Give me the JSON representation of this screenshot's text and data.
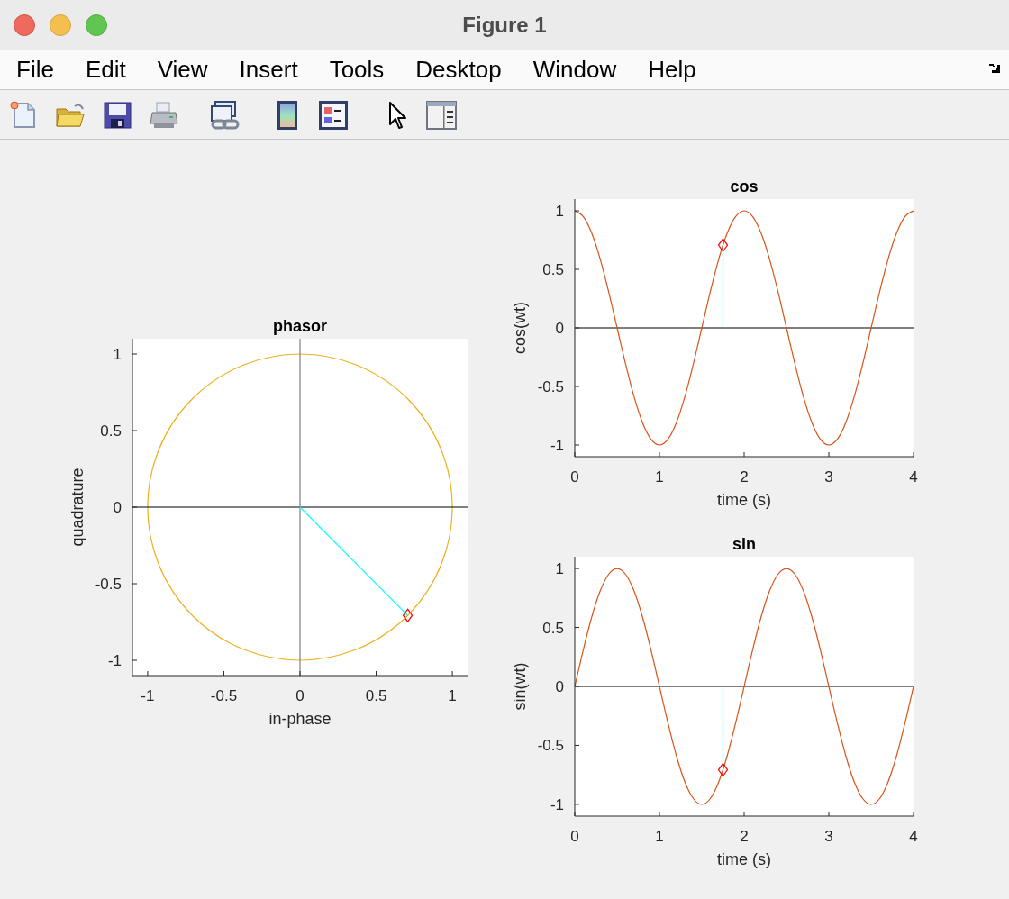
{
  "window": {
    "title": "Figure 1"
  },
  "menu": [
    "File",
    "Edit",
    "View",
    "Insert",
    "Tools",
    "Desktop",
    "Window",
    "Help"
  ],
  "axes": [
    {
      "chart_data": {
        "type": "line",
        "title": "phasor",
        "xlabel": "in-phase",
        "ylabel": "quadrature",
        "xlim": [
          -1.1,
          1.1
        ],
        "ylim": [
          -1.1,
          1.1
        ],
        "xticks": [
          -1,
          -0.5,
          0,
          0.5,
          1
        ],
        "yticks": [
          -1,
          -0.5,
          0,
          0.5,
          1
        ],
        "ref_lines": [
          {
            "axis": "y",
            "value": 0,
            "color": "#000000"
          },
          {
            "axis": "x",
            "value": 0,
            "color": "#808080"
          }
        ],
        "series": [
          {
            "color": "#00ffff",
            "x": [
              0,
              0.707
            ],
            "values": [
              0,
              -0.707
            ]
          },
          {
            "color": "#ff0000",
            "marker": "diamond",
            "x": [
              0.707
            ],
            "values": [
              -0.707
            ]
          }
        ]
      }
    },
    {
      "chart_data": {
        "type": "line",
        "title": "cos",
        "xlabel": "time (s)",
        "ylabel": "cos(wt)",
        "xlim": [
          0,
          4
        ],
        "ylim": [
          -1.1,
          1.1
        ],
        "xticks": [
          0,
          1,
          2,
          3,
          4
        ],
        "yticks": [
          -1,
          -0.5,
          0,
          0.5,
          1
        ],
        "ref_lines": [
          {
            "axis": "y",
            "value": 0,
            "color": "#000000"
          }
        ],
        "series": [
          {
            "color": "#d95319",
            "x": [
              0,
              0.1,
              0.2,
              0.3,
              0.4,
              0.5,
              0.6,
              0.7,
              0.8,
              0.9,
              1,
              1.1,
              1.2,
              1.3,
              1.4,
              1.5,
              1.6,
              1.7,
              1.8,
              1.9,
              2,
              2.1,
              2.2,
              2.3,
              2.4,
              2.5,
              2.6,
              2.7,
              2.8,
              2.9,
              3,
              3.1,
              3.2,
              3.3,
              3.4,
              3.5,
              3.6,
              3.7,
              3.8,
              3.9,
              4
            ],
            "values": [
              1,
              0.951,
              0.809,
              0.588,
              0.309,
              0,
              -0.309,
              -0.588,
              -0.809,
              -0.951,
              -1,
              -0.951,
              -0.809,
              -0.588,
              -0.309,
              0,
              0.309,
              0.588,
              0.809,
              0.951,
              1,
              0.951,
              0.809,
              0.588,
              0.309,
              0,
              -0.309,
              -0.588,
              -0.809,
              -0.951,
              -1,
              -0.951,
              -0.809,
              -0.588,
              -0.309,
              0,
              0.309,
              0.588,
              0.809,
              0.951,
              1
            ]
          },
          {
            "color": "#00ffff",
            "x": [
              1.75,
              1.75
            ],
            "values": [
              0,
              0.707
            ]
          },
          {
            "color": "#ff0000",
            "marker": "diamond",
            "x": [
              1.75
            ],
            "values": [
              0.707
            ]
          }
        ]
      }
    },
    {
      "chart_data": {
        "type": "line",
        "title": "sin",
        "xlabel": "time (s)",
        "ylabel": "sin(wt)",
        "xlim": [
          0,
          4
        ],
        "ylim": [
          -1.1,
          1.1
        ],
        "xticks": [
          0,
          1,
          2,
          3,
          4
        ],
        "yticks": [
          -1,
          -0.5,
          0,
          0.5,
          1
        ],
        "ref_lines": [
          {
            "axis": "y",
            "value": 0,
            "color": "#000000"
          }
        ],
        "series": [
          {
            "color": "#d95319",
            "x": [
              0,
              0.1,
              0.2,
              0.3,
              0.4,
              0.5,
              0.6,
              0.7,
              0.8,
              0.9,
              1,
              1.1,
              1.2,
              1.3,
              1.4,
              1.5,
              1.6,
              1.7,
              1.8,
              1.9,
              2,
              2.1,
              2.2,
              2.3,
              2.4,
              2.5,
              2.6,
              2.7,
              2.8,
              2.9,
              3,
              3.1,
              3.2,
              3.3,
              3.4,
              3.5,
              3.6,
              3.7,
              3.8,
              3.9,
              4
            ],
            "values": [
              0,
              0.309,
              0.588,
              0.809,
              0.951,
              1,
              0.951,
              0.809,
              0.588,
              0.309,
              0,
              -0.309,
              -0.588,
              -0.809,
              -0.951,
              -1,
              -0.951,
              -0.809,
              -0.588,
              -0.309,
              0,
              0.309,
              0.588,
              0.809,
              0.951,
              1,
              0.951,
              0.809,
              0.588,
              0.309,
              0,
              -0.309,
              -0.588,
              -0.809,
              -0.951,
              -1,
              -0.951,
              -0.809,
              -0.588,
              -0.309,
              0
            ]
          },
          {
            "color": "#00ffff",
            "x": [
              1.75,
              1.75
            ],
            "values": [
              0,
              -0.707
            ]
          },
          {
            "color": "#ff0000",
            "marker": "diamond",
            "x": [
              1.75
            ],
            "values": [
              -0.707
            ]
          }
        ]
      }
    }
  ]
}
